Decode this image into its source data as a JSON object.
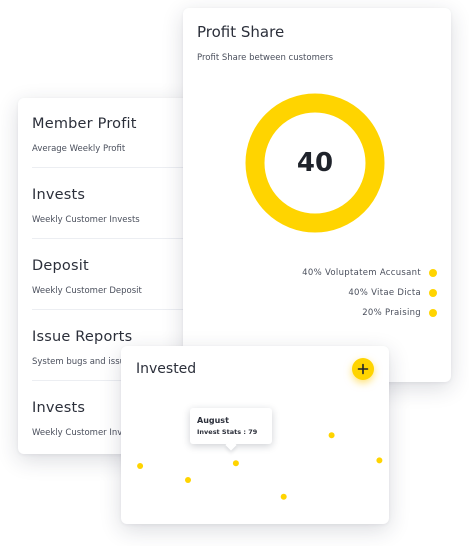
{
  "colors": {
    "accent": "#ffd400",
    "track": "#ffd400"
  },
  "list": {
    "items": [
      {
        "title": "Member Profit",
        "subtitle": "Average Weekly Profit"
      },
      {
        "title": "Invests",
        "subtitle": "Weekly Customer Invests"
      },
      {
        "title": "Deposit",
        "subtitle": "Weekly Customer Deposit"
      },
      {
        "title": "Issue Reports",
        "subtitle": "System bugs and issues"
      },
      {
        "title": "Invests",
        "subtitle": "Weekly Customer Invests"
      }
    ]
  },
  "profit_share": {
    "title": "Profit Share",
    "subtitle": "Profit Share between customers",
    "value": "40",
    "legend": [
      {
        "label": "40% Voluptatem Accusant",
        "icon": "dot-icon"
      },
      {
        "label": "40% Vitae Dicta",
        "icon": "dot-icon"
      },
      {
        "label": "20% Praising",
        "icon": "dot-icon"
      }
    ]
  },
  "invested": {
    "title": "Invested",
    "add_icon": "plus-icon",
    "tooltip": {
      "title": "August",
      "label": "Invest Stats : 79"
    }
  },
  "chart_data": {
    "type": "scatter",
    "title": "Invested",
    "points": [
      {
        "x": 1,
        "y": 40
      },
      {
        "x": 2,
        "y": 30
      },
      {
        "x": 3,
        "y": 42
      },
      {
        "x": 4,
        "y": 18
      },
      {
        "x": 5,
        "y": 62
      },
      {
        "x": 6,
        "y": 44
      }
    ],
    "xlim": [
      0.6,
      6.2
    ],
    "ylim": [
      0,
      100
    ],
    "grid": false,
    "color": "#ffd400"
  }
}
